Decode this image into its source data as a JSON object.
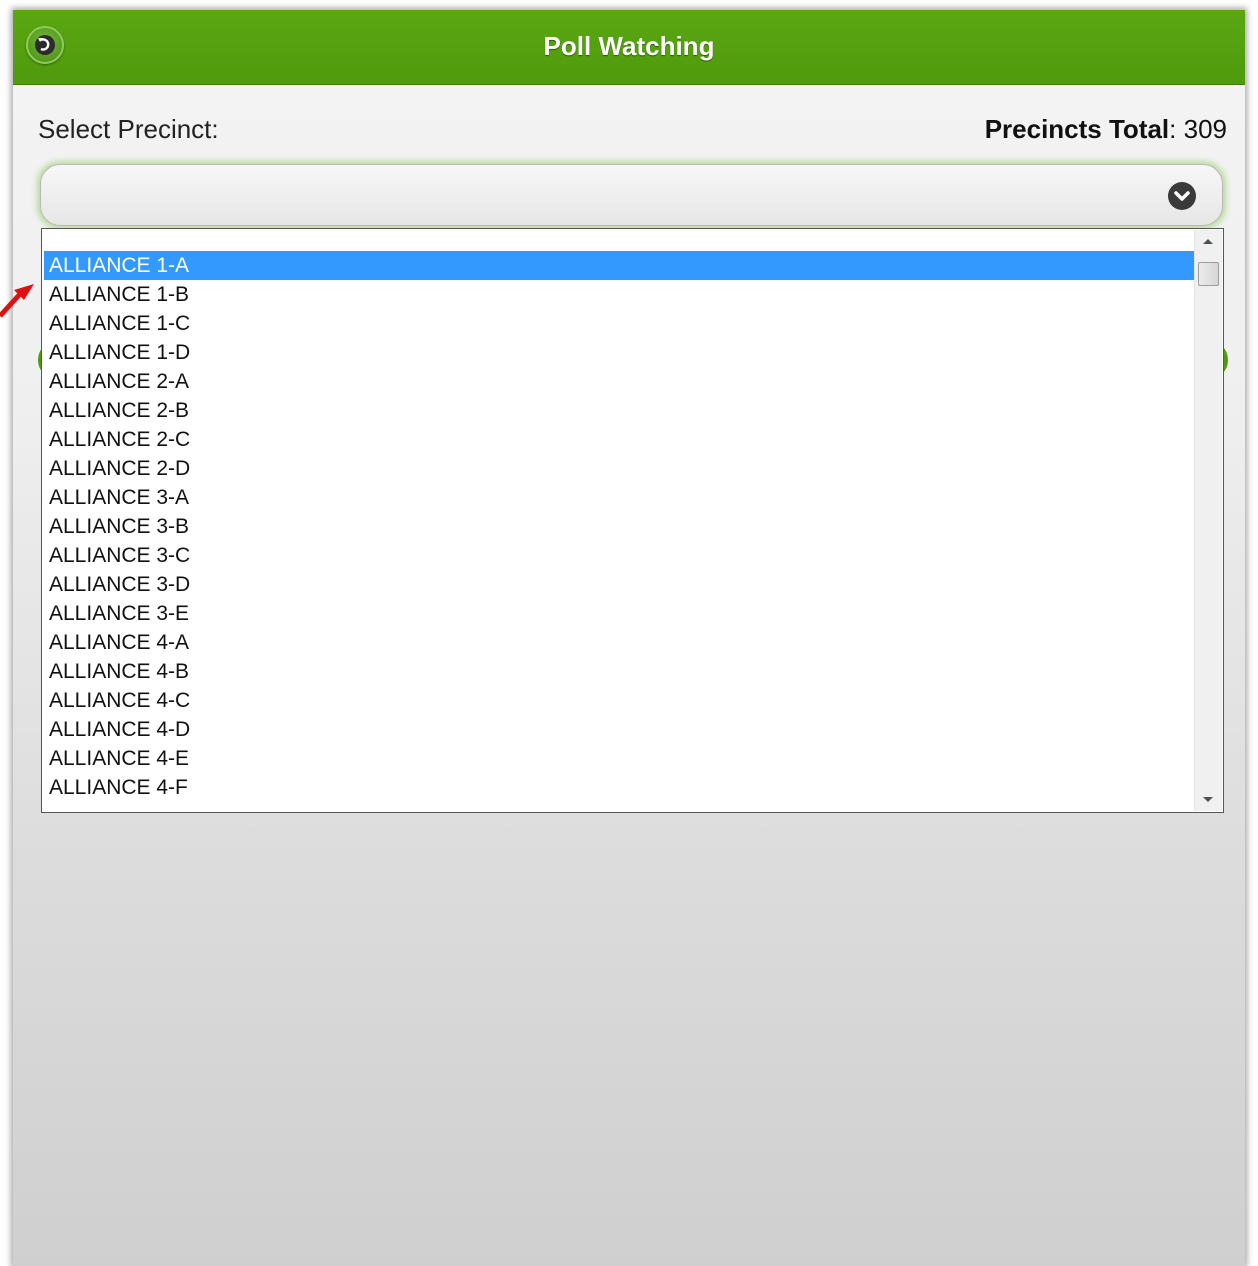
{
  "header": {
    "title": "Poll Watching",
    "back_icon": "back-arrow-icon"
  },
  "form": {
    "select_label": "Select Precinct:",
    "total_label": "Precincts Total",
    "total_separator": ": ",
    "total_value": "309",
    "select_value": "",
    "dropdown_icon": "chevron-down-icon"
  },
  "dropdown": {
    "selected_option": "ALLIANCE 1-A",
    "options": [
      "",
      "ALLIANCE 1-A",
      "ALLIANCE 1-B",
      "ALLIANCE 1-C",
      "ALLIANCE 1-D",
      "ALLIANCE 2-A",
      "ALLIANCE 2-B",
      "ALLIANCE 2-C",
      "ALLIANCE 2-D",
      "ALLIANCE 3-A",
      "ALLIANCE 3-B",
      "ALLIANCE 3-C",
      "ALLIANCE 3-D",
      "ALLIANCE 3-E",
      "ALLIANCE 4-A",
      "ALLIANCE 4-B",
      "ALLIANCE 4-C",
      "ALLIANCE 4-D",
      "ALLIANCE 4-E",
      "ALLIANCE 4-F"
    ]
  },
  "colors": {
    "header_green": "#55a210",
    "selection_blue": "#3399ff",
    "annotation_red": "#e01010"
  }
}
